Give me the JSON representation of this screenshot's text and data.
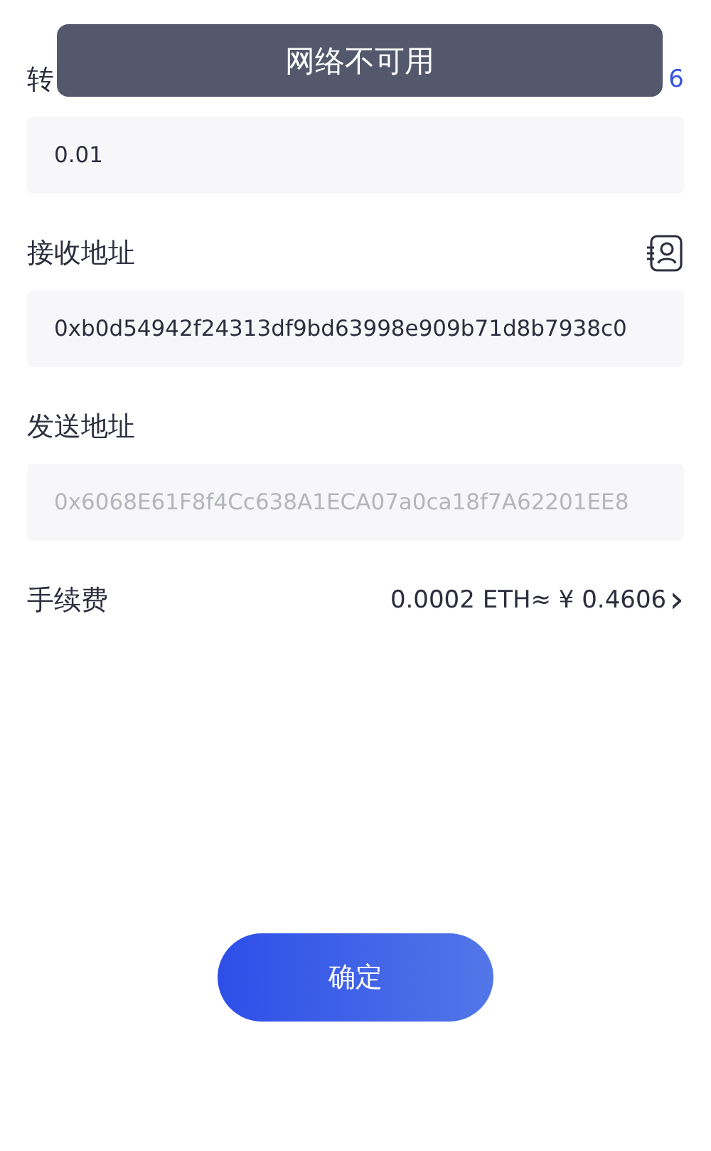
{
  "toast": {
    "message": "网络不可用"
  },
  "amount": {
    "label": "转",
    "balance": "6",
    "value": "0.01"
  },
  "receiver": {
    "label": "接收地址",
    "value": "0xb0d54942f24313df9bd63998e909b71d8b7938c0"
  },
  "sender": {
    "label": "发送地址",
    "value": "0x6068E61F8f4Cc638A1ECA07a0ca18f7A62201EE8",
    "disabled": true
  },
  "fee": {
    "label": "手续费",
    "value": "0.0002 ETH≈ ¥ 0.4606",
    "chevron": "›"
  },
  "confirm_button": {
    "label": "确定"
  }
}
